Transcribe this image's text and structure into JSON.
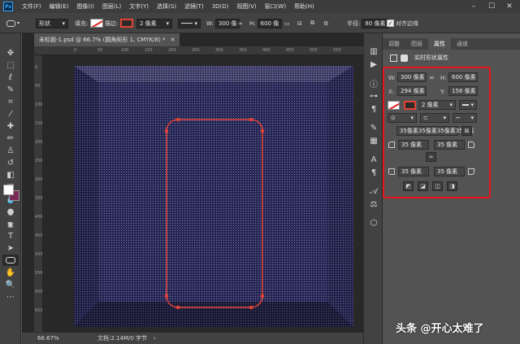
{
  "menubar": {
    "logo": "Ps",
    "items": [
      "文件(F)",
      "编辑(E)",
      "图像(I)",
      "图层(L)",
      "文字(Y)",
      "选择(S)",
      "滤镜(T)",
      "3D(D)",
      "视图(V)",
      "窗口(W)",
      "帮助(H)"
    ]
  },
  "options": {
    "mode": "形状",
    "fill_label": "填充:",
    "stroke_label": "描边:",
    "stroke_width": "2 像素",
    "w_label": "W:",
    "w_value": "300 像",
    "h_label": "H:",
    "h_value": "600 像",
    "radius_label": "半径:",
    "radius_value": "80 像素",
    "align_edges": "对齐边缘"
  },
  "document": {
    "tab_title": "未标题-1.psd @ 66.7% (圆角矩形 1, CMYK/8) *",
    "zoom": "66.67%",
    "doc_info": "文档:2.14M/0 字节",
    "ruler_top": [
      "0",
      "50",
      "100",
      "150",
      "200",
      "250",
      "300",
      "350",
      "400",
      "450",
      "500",
      "550"
    ],
    "ruler_left": [
      "0",
      "50",
      "100",
      "150",
      "200",
      "250",
      "300",
      "350",
      "400",
      "450",
      "500",
      "550",
      "600",
      "650"
    ]
  },
  "panel": {
    "tabs": [
      "调整",
      "图层",
      "属性",
      "通道"
    ],
    "active_tab": "属性",
    "section_title": "实时形状属性",
    "w_label": "W:",
    "w_value": "300 像素",
    "h_label": "H:",
    "h_value": "600 像素",
    "x_label": "X:",
    "x_value": "294 像素",
    "y_label": "Y:",
    "y_value": "158 像素",
    "stroke_width": "2 像素",
    "corners_summary": "35像素35像素35像素35像素",
    "corner_tl": "35 像素",
    "corner_tr": "35 像素",
    "corner_bl": "35 像素",
    "corner_br": "35 像素"
  },
  "watermark": "头条 @开心太难了",
  "colors": {
    "canvas": "#262652",
    "shape_stroke": "#e34234",
    "highlight": "#e8161c",
    "fg_color": "#ffffff",
    "bg_color": "#7a2a55"
  }
}
